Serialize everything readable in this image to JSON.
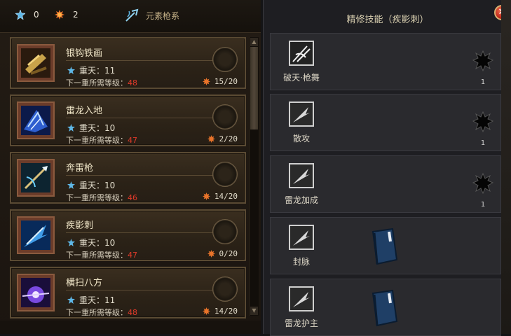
{
  "currencies": [
    {
      "icon": "star-icon",
      "value": "0"
    },
    {
      "icon": "sun-icon",
      "value": "2"
    }
  ],
  "tree": {
    "icon": "lance-icon",
    "title": "元素枪系"
  },
  "skills": [
    {
      "name": "银钩铁画",
      "heaven_label": "重天：11",
      "req_label": "下一重所需等级：",
      "req_level": "48",
      "progress": "15/20",
      "icon": "chain-hook-icon"
    },
    {
      "name": "雷龙入地",
      "heaven_label": "重天：10",
      "req_label": "下一重所需等级：",
      "req_level": "47",
      "progress": "2/20",
      "icon": "thunder-dragon-icon"
    },
    {
      "name": "奔雷枪",
      "heaven_label": "重天：10",
      "req_label": "下一重所需等级：",
      "req_level": "46",
      "progress": "14/20",
      "icon": "thunder-spear-icon"
    },
    {
      "name": "疾影刺",
      "heaven_label": "重天：10",
      "req_label": "下一重所需等级：",
      "req_level": "47",
      "progress": "0/20",
      "icon": "shadow-thrust-icon"
    },
    {
      "name": "横扫八方",
      "heaven_label": "重天：11",
      "req_label": "下一重所需等级：",
      "req_level": "48",
      "progress": "14/20",
      "icon": "sweep-icon"
    }
  ],
  "refine": {
    "title": "精修技能（疾影刺）",
    "close_icon": "close-icon",
    "items": [
      {
        "label": "破天·枪舞",
        "count": "1",
        "icon": "spear-dance-icon",
        "slot": "socket"
      },
      {
        "label": "散攻",
        "count": "1",
        "icon": "spear-icon",
        "slot": "socket"
      },
      {
        "label": "雷龙加成",
        "count": "1",
        "icon": "spear-icon",
        "slot": "socket"
      },
      {
        "label": "封脉",
        "icon": "spear-icon",
        "slot": "book"
      },
      {
        "label": "雷龙护主",
        "icon": "spear-icon",
        "slot": "book"
      }
    ]
  },
  "colors": {
    "required_level": "#e03a2a",
    "accent_gold": "#c8b48a",
    "star_blue": "#5fb8e8",
    "sun_orange": "#e8732a"
  }
}
